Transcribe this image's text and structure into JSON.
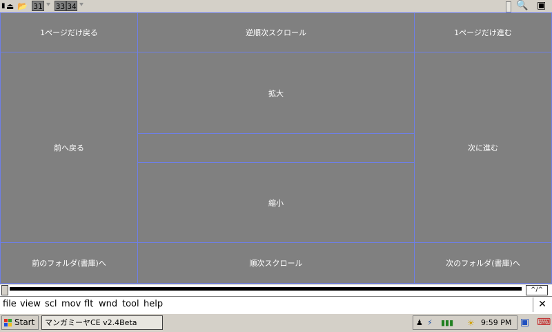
{
  "toolbar": {
    "page_single": "31",
    "page_spread_left": "33",
    "page_spread_right": "34"
  },
  "zones": {
    "prev_page": "1ページだけ戻る",
    "reverse_scroll": "逆順次スクロール",
    "next_page": "1ページだけ進む",
    "back": "前へ戻る",
    "zoom_in": "拡大",
    "center": "",
    "zoom_out": "縮小",
    "forward": "次に進む",
    "prev_folder": "前のフォルダ(書庫)へ",
    "scroll": "順次スクロール",
    "next_folder": "次のフォルダ(書庫)へ"
  },
  "scroll_label": "^/^",
  "menu": {
    "file": "file",
    "view": "view",
    "scl": "scl",
    "mov": "mov",
    "flt": "flt",
    "wnd": "wnd",
    "tool": "tool",
    "help": "help",
    "close": "✕"
  },
  "taskbar": {
    "start_label": "Start",
    "task_label": "マンガミーヤCE v2.4Beta",
    "clock": "9:59 PM"
  }
}
